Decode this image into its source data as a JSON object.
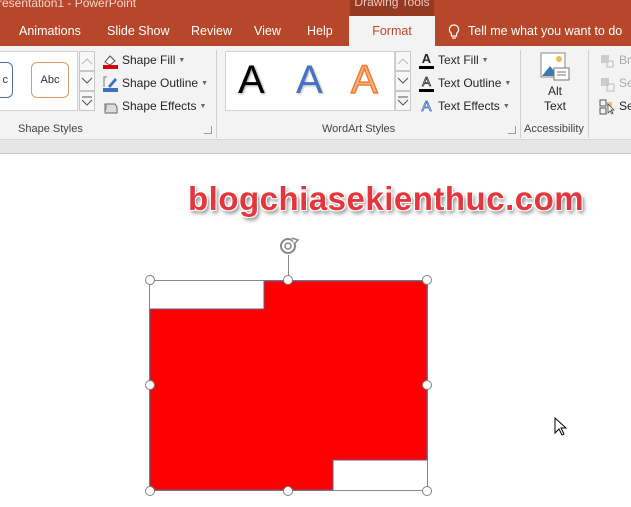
{
  "titlebar": {
    "document_title": "resentation1 - PowerPoint",
    "context_tab_group": "Drawing Tools"
  },
  "tabs": [
    {
      "label": "Animations"
    },
    {
      "label": "Slide Show"
    },
    {
      "label": "Review"
    },
    {
      "label": "View"
    },
    {
      "label": "Help"
    },
    {
      "label": "Format",
      "active": true
    }
  ],
  "tell_me": {
    "placeholder": "Tell me what you want to do",
    "icon": "lightbulb-icon"
  },
  "ribbon": {
    "shape_styles": {
      "label": "Shape Styles",
      "gallery_items": [
        {
          "label": "c",
          "border_color": "#4e6e9a"
        },
        {
          "label": "Abc",
          "border_color": "#d99a63"
        }
      ],
      "commands": [
        {
          "label": "Shape Fill",
          "icon": "paint-bucket-icon",
          "color": "#e00000"
        },
        {
          "label": "Shape Outline",
          "icon": "pen-outline-icon",
          "color": "#3f6fbf"
        },
        {
          "label": "Shape Effects",
          "icon": "shape-effects-icon"
        }
      ]
    },
    "wordart_styles": {
      "label": "WordArt Styles",
      "gallery_items": [
        {
          "label": "A",
          "style": "black"
        },
        {
          "label": "A",
          "style": "blue"
        },
        {
          "label": "A",
          "style": "orange-outline"
        }
      ],
      "commands": [
        {
          "label": "Text Fill",
          "icon": "text-fill-icon"
        },
        {
          "label": "Text Outline",
          "icon": "text-outline-icon"
        },
        {
          "label": "Text Effects",
          "icon": "text-effects-icon"
        }
      ]
    },
    "accessibility": {
      "label": "Accessibility",
      "alt_text_line1": "Alt",
      "alt_text_line2": "Text"
    },
    "arrange": {
      "items": [
        {
          "label": "Br",
          "enabled": false
        },
        {
          "label": "Se",
          "enabled": false
        },
        {
          "label": "Se",
          "enabled": true
        }
      ]
    }
  },
  "slide": {
    "watermark_text": "blogchiasekienthuc.com",
    "shape": {
      "fill_color": "#ff0000",
      "type": "freeform-notched-rectangle",
      "selected": true
    }
  }
}
